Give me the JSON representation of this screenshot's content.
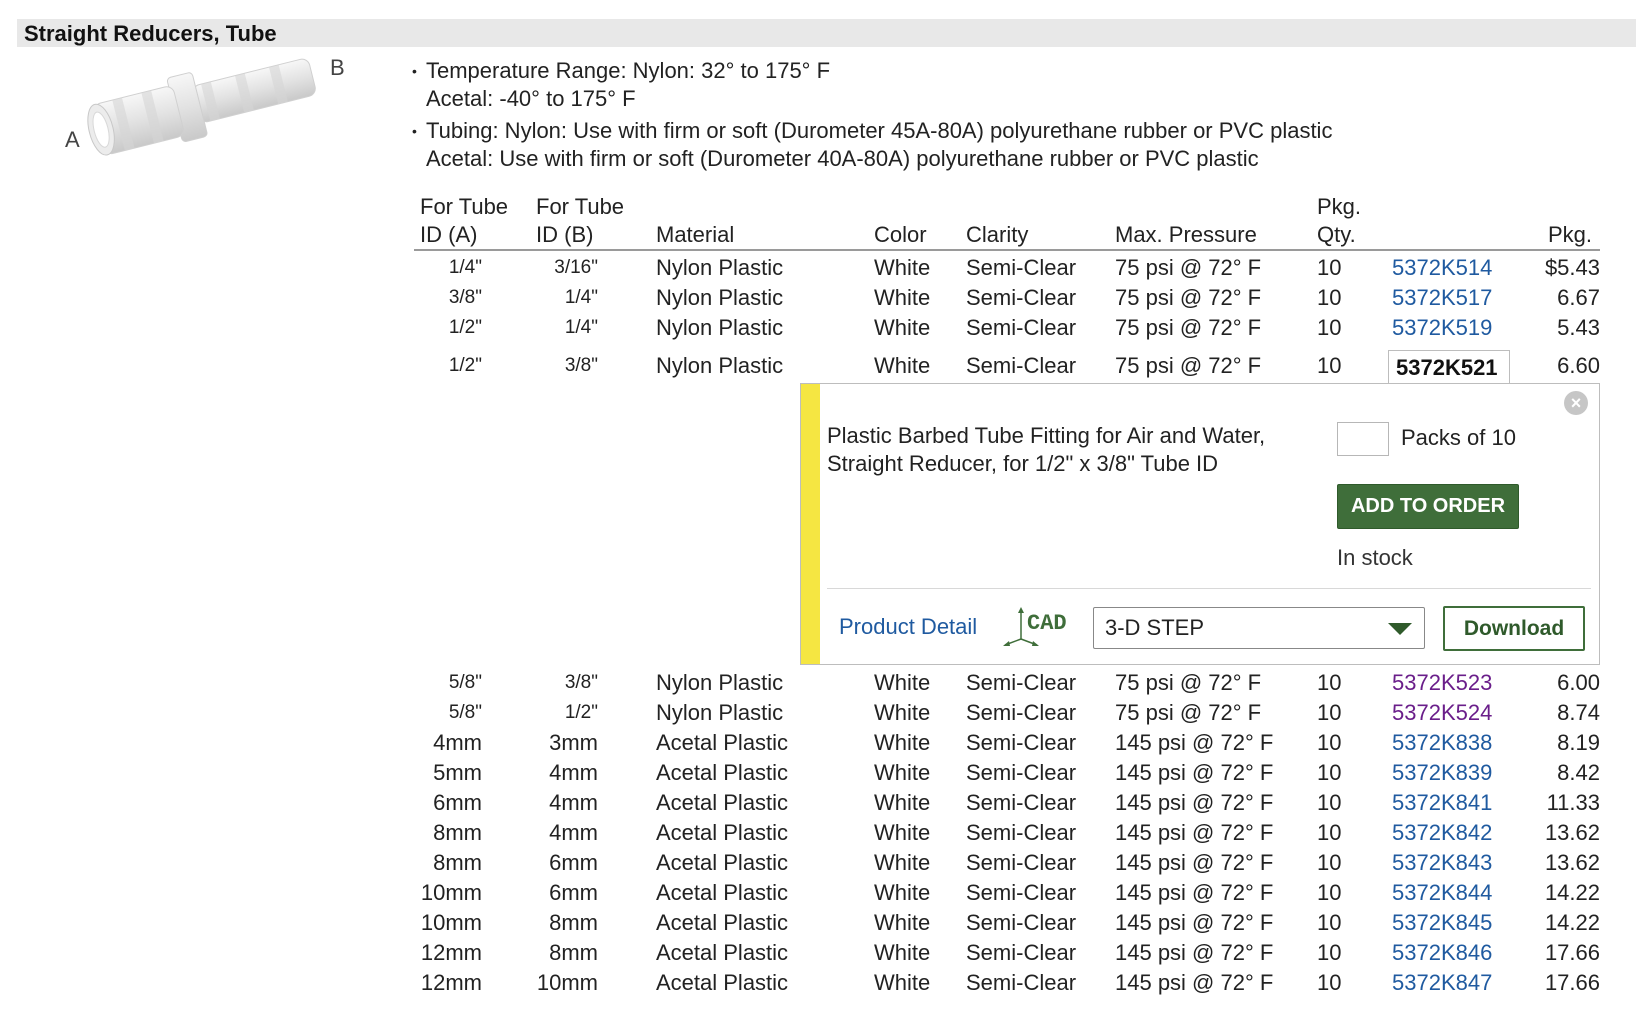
{
  "page_title": "Straight Reducers, Tube",
  "image_labels": {
    "a": "A",
    "b": "B"
  },
  "bullets": [
    {
      "line1": "Temperature Range: Nylon: 32° to 175° F",
      "line2": "Acetal: -40° to 175° F"
    },
    {
      "line1": "Tubing: Nylon: Use with firm or soft (Durometer 45A-80A) polyurethane rubber or PVC plastic",
      "line2": "Acetal: Use with firm or soft (Durometer 40A-80A) polyurethane rubber or PVC plastic"
    }
  ],
  "columns": {
    "tube_a_1": "For Tube",
    "tube_a_2": "ID (A)",
    "tube_b_1": "For Tube",
    "tube_b_2": "ID (B)",
    "material": "Material",
    "color": "Color",
    "clarity": "Clarity",
    "pressure": "Max. Pressure",
    "qty_1": "Pkg.",
    "qty_2": "Qty.",
    "price": "Pkg."
  },
  "rows": [
    {
      "a": "1/4\"",
      "b": "3/16\"",
      "material": "Nylon Plastic",
      "color": "White",
      "clarity": "Semi-Clear",
      "pressure": "75 psi @ 72° F",
      "qty": "10",
      "part": "5372K514",
      "price": "$5.43"
    },
    {
      "a": "3/8\"",
      "b": "1/4\"",
      "material": "Nylon Plastic",
      "color": "White",
      "clarity": "Semi-Clear",
      "pressure": "75 psi @ 72° F",
      "qty": "10",
      "part": "5372K517",
      "price": "6.67"
    },
    {
      "a": "1/2\"",
      "b": "1/4\"",
      "material": "Nylon Plastic",
      "color": "White",
      "clarity": "Semi-Clear",
      "pressure": "75 psi @ 72° F",
      "qty": "10",
      "part": "5372K519",
      "price": "5.43"
    },
    {
      "a": "1/2\"",
      "b": "3/8\"",
      "material": "Nylon Plastic",
      "color": "White",
      "clarity": "Semi-Clear",
      "pressure": "75 psi @ 72° F",
      "qty": "10",
      "part": "5372K521",
      "price": "6.60"
    },
    {
      "a": "5/8\"",
      "b": "3/8\"",
      "material": "Nylon Plastic",
      "color": "White",
      "clarity": "Semi-Clear",
      "pressure": "75 psi @ 72° F",
      "qty": "10",
      "part": "5372K523",
      "price": "6.00"
    },
    {
      "a": "5/8\"",
      "b": "1/2\"",
      "material": "Nylon Plastic",
      "color": "White",
      "clarity": "Semi-Clear",
      "pressure": "75 psi @ 72° F",
      "qty": "10",
      "part": "5372K524",
      "price": "8.74"
    },
    {
      "a": "4mm",
      "b": "3mm",
      "material": "Acetal Plastic",
      "color": "White",
      "clarity": "Semi-Clear",
      "pressure": "145 psi @ 72° F",
      "qty": "10",
      "part": "5372K838",
      "price": "8.19"
    },
    {
      "a": "5mm",
      "b": "4mm",
      "material": "Acetal Plastic",
      "color": "White",
      "clarity": "Semi-Clear",
      "pressure": "145 psi @ 72° F",
      "qty": "10",
      "part": "5372K839",
      "price": "8.42"
    },
    {
      "a": "6mm",
      "b": "4mm",
      "material": "Acetal Plastic",
      "color": "White",
      "clarity": "Semi-Clear",
      "pressure": "145 psi @ 72° F",
      "qty": "10",
      "part": "5372K841",
      "price": "11.33"
    },
    {
      "a": "8mm",
      "b": "4mm",
      "material": "Acetal Plastic",
      "color": "White",
      "clarity": "Semi-Clear",
      "pressure": "145 psi @ 72° F",
      "qty": "10",
      "part": "5372K842",
      "price": "13.62"
    },
    {
      "a": "8mm",
      "b": "6mm",
      "material": "Acetal Plastic",
      "color": "White",
      "clarity": "Semi-Clear",
      "pressure": "145 psi @ 72° F",
      "qty": "10",
      "part": "5372K843",
      "price": "13.62"
    },
    {
      "a": "10mm",
      "b": "6mm",
      "material": "Acetal Plastic",
      "color": "White",
      "clarity": "Semi-Clear",
      "pressure": "145 psi @ 72° F",
      "qty": "10",
      "part": "5372K844",
      "price": "14.22"
    },
    {
      "a": "10mm",
      "b": "8mm",
      "material": "Acetal Plastic",
      "color": "White",
      "clarity": "Semi-Clear",
      "pressure": "145 psi @ 72° F",
      "qty": "10",
      "part": "5372K845",
      "price": "14.22"
    },
    {
      "a": "12mm",
      "b": "8mm",
      "material": "Acetal Plastic",
      "color": "White",
      "clarity": "Semi-Clear",
      "pressure": "145 psi @ 72° F",
      "qty": "10",
      "part": "5372K846",
      "price": "17.66"
    },
    {
      "a": "12mm",
      "b": "10mm",
      "material": "Acetal Plastic",
      "color": "White",
      "clarity": "Semi-Clear",
      "pressure": "145 psi @ 72° F",
      "qty": "10",
      "part": "5372K847",
      "price": "17.66"
    }
  ],
  "popup": {
    "description": "Plastic Barbed Tube Fitting for Air and Water, Straight Reducer, for 1/2\" x 3/8\" Tube ID",
    "qty_value": "",
    "qty_label": "Packs of 10",
    "add_button": "ADD TO ORDER",
    "stock": "In stock",
    "product_detail": "Product Detail",
    "cad_label": "CAD",
    "format_selected": "3-D STEP",
    "download_button": "Download",
    "close_icon": "close-icon"
  },
  "colors": {
    "link": "#1f5aa0",
    "visited_link": "#6a1e8a",
    "accent": "#f5e642",
    "button": "#3f6e3a"
  }
}
